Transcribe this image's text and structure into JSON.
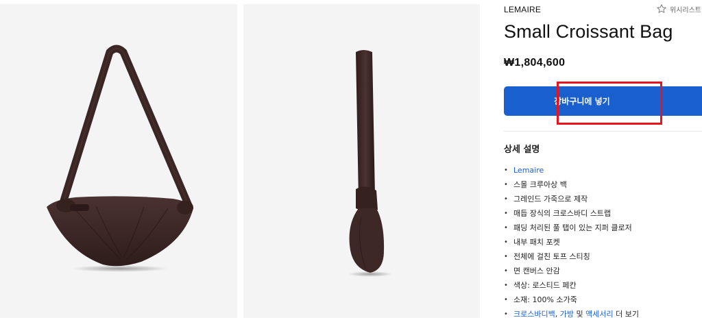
{
  "product": {
    "brand": "LEMAIRE",
    "wishlist_label": "위시리스트",
    "title": "Small Croissant Bag",
    "price": "₩1,804,600",
    "add_to_cart": "장바구니에 넣기",
    "details_heading": "상세 설명",
    "details": [
      "Lemaire",
      "스몰 크루아상 백",
      "그레인드 가죽으로 제작",
      "매듭 장식의 크로스바디 스트랩",
      "패딩 처리된 풀 탭이 있는 지퍼 클로저",
      "내부 패치 포켓",
      "전체에 걸친 토프 스티칭",
      "면 캔버스 안감",
      "색상: 로스티드 페칸",
      "소재: 100% 소가죽"
    ],
    "more_links": {
      "link1": "크로스바디백",
      "sep1": ", ",
      "link2": "가방",
      "sep2": " 및 ",
      "link3": "액세서리",
      "suffix": " 더 보기"
    }
  },
  "colors": {
    "accent": "#1a5fce",
    "highlight": "#e8141c",
    "leather": "#3a2624",
    "image_bg": "#f4f4f4"
  },
  "icons": {
    "wishlist": "star-outline-icon",
    "bullet": "bullet-dot"
  }
}
